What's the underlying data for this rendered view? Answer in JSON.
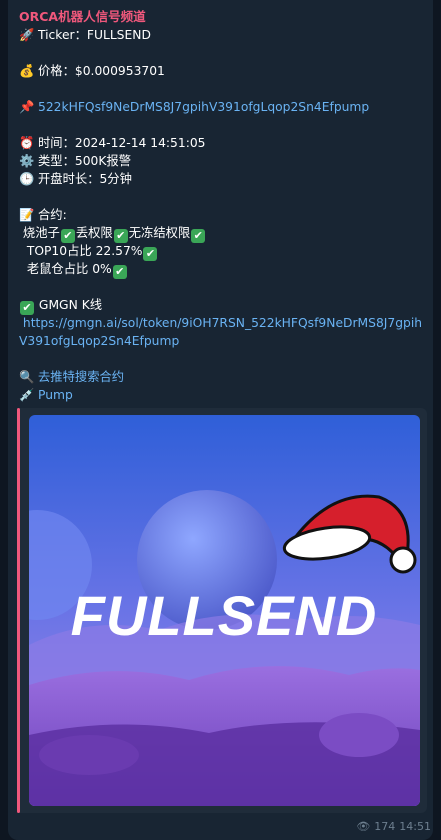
{
  "channel_name": "ORCA机器人信号频道",
  "ticker": {
    "emoji": "🚀",
    "text": "Ticker：FULLSEND"
  },
  "price": {
    "emoji": "💰",
    "text": "价格：$0.000953701"
  },
  "contract_address": {
    "emoji": "📌",
    "text": "522kHFQsf9NeDrMS8J7gpihV391ofgLqop2Sn4Efpump"
  },
  "time": {
    "emoji": "⏰",
    "text": "时间：2024-12-14 14:51:05"
  },
  "type": {
    "emoji": "⚙️",
    "text": "类型：500K报警"
  },
  "open_duration": {
    "emoji": "🕒",
    "text": "开盘时长：5分钟"
  },
  "contract_section": {
    "emoji": "📝",
    "title": "合约:",
    "row1": {
      "a": "烧池子",
      "b": "丢权限",
      "c": "无冻结权限"
    },
    "row2": {
      "a": "TOP10占比  22.57%"
    },
    "row3": {
      "a": "老鼠仓占比  0%"
    }
  },
  "gmgn": {
    "label": "GMGN K线",
    "url": "https://gmgn.ai/sol/token/9iOH7RSN_522kHFQsf9NeDrMS8J7gpihV391ofgLqop2Sn4Efpump"
  },
  "twitter_link": {
    "emoji": "🔍",
    "text": "去推特搜索合约"
  },
  "pump_link": {
    "emoji": "💉",
    "text": "Pump"
  },
  "preview_image": {
    "text": "FULLSEND"
  },
  "footer": {
    "views": "174",
    "time": "14:51"
  },
  "colors": {
    "background": "#0e1621",
    "bubble": "#182533",
    "link": "#6ab3f3",
    "accent": "#f0587c",
    "check": "#3aa657"
  }
}
